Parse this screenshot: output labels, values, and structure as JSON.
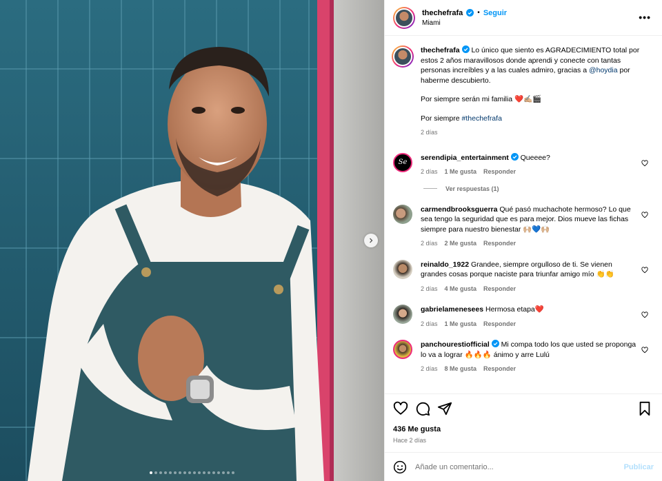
{
  "header": {
    "username": "thechefrafa",
    "separator": "•",
    "follow_label": "Seguir",
    "location": "Miami",
    "more_label": "•••"
  },
  "caption": {
    "username": "thechefrafa",
    "text_1": "Lo único que siento es AGRADECIMIENTO total por estos 2 años maravillosos donde aprendi y conecte con tantas personas increíbles y a las cuales admiro, gracias a",
    "mention": "@hoydia",
    "text_2": "por haberme descubierto.",
    "line_2": "Por siempre serán mi familia ❤️✍🏼🎬",
    "line_3_prefix": "Por siempre",
    "hashtag": "#thechefrafa",
    "time": "2 días"
  },
  "comments": [
    {
      "username": "serendipia_entertainment",
      "verified": true,
      "text": "Queeee?",
      "time": "2 días",
      "likes": "1 Me gusta",
      "reply": "Responder",
      "view_replies": "Ver respuestas (1)"
    },
    {
      "username": "carmendbrooksguerra",
      "verified": false,
      "text": "Qué pasó muchachote hermoso? Lo que sea tengo la seguridad que es para mejor. Dios mueve las fichas siempre para nuestro bienestar 🙌🏼💙🙌🏼",
      "time": "2 días",
      "likes": "2 Me gusta",
      "reply": "Responder"
    },
    {
      "username": "reinaldo_1922",
      "verified": false,
      "text": "Grandee, siempre orgulloso de ti. Se vienen grandes cosas porque naciste para triunfar amigo mío 👏👏",
      "time": "2 días",
      "likes": "4 Me gusta",
      "reply": "Responder"
    },
    {
      "username": "gabrielamenesees",
      "verified": false,
      "text": "Hermosa etapa❤️",
      "time": "2 días",
      "likes": "1 Me gusta",
      "reply": "Responder"
    },
    {
      "username": "panchourestiofficial",
      "verified": true,
      "text": "Mi compa todo los que usted se proponga lo va a lograr 🔥🔥🔥 ánimo y arre Lulú",
      "time": "2 días",
      "likes": "8 Me gusta",
      "reply": "Responder"
    }
  ],
  "footer": {
    "likes_count": "436 Me gusta",
    "posted": "Hace 2 días",
    "comment_placeholder": "Añade un comentario...",
    "publish_label": "Publicar"
  },
  "carousel": {
    "total": 18,
    "active_index": 0
  },
  "colors": {
    "accent": "#0095f6",
    "mention": "#00376b",
    "muted": "#737373",
    "publish_disabled": "#b2dffc",
    "verified": "#0095f6",
    "like_heart": "#ed4956"
  }
}
